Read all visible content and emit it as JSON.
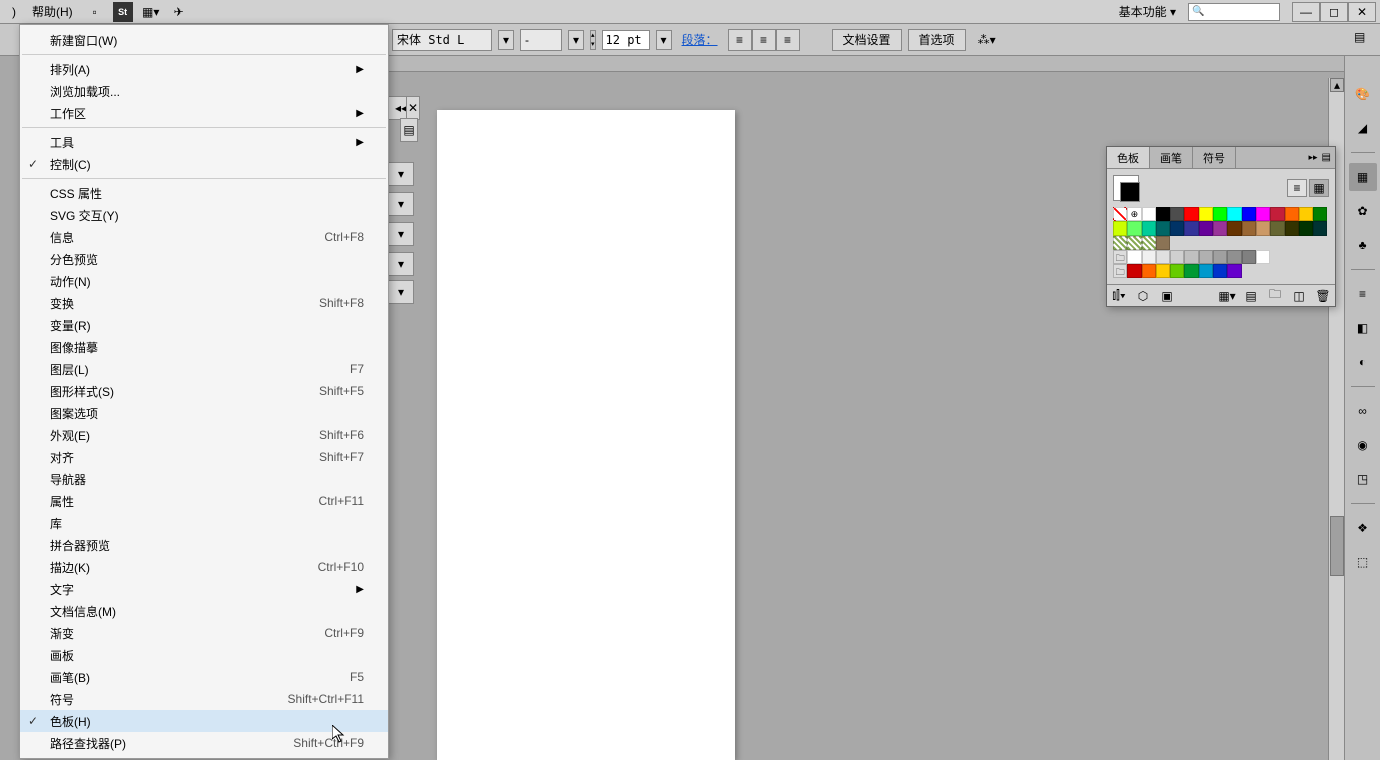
{
  "menubar": {
    "left_truncated": ")",
    "help": "帮助(H)",
    "workspace_switcher": "基本功能",
    "search_placeholder": ""
  },
  "controlbar": {
    "font_name": "宋体 Std L",
    "font_style": "-",
    "font_size": "12 pt",
    "paragraph_link": "段落：",
    "doc_setup": "文档设置",
    "preferences": "首选项"
  },
  "dropdown": {
    "items": [
      {
        "label": "新建窗口(W)"
      },
      {
        "sep": true
      },
      {
        "label": "排列(A)",
        "submenu": true
      },
      {
        "label": "浏览加载项..."
      },
      {
        "label": "工作区",
        "submenu": true
      },
      {
        "sep": true
      },
      {
        "label": "工具",
        "submenu": true
      },
      {
        "label": "控制(C)",
        "checked": true
      },
      {
        "sep": true
      },
      {
        "label": "CSS 属性"
      },
      {
        "label": "SVG 交互(Y)"
      },
      {
        "label": "信息",
        "shortcut": "Ctrl+F8"
      },
      {
        "label": "分色预览"
      },
      {
        "label": "动作(N)"
      },
      {
        "label": "变换",
        "shortcut": "Shift+F8"
      },
      {
        "label": "变量(R)"
      },
      {
        "label": "图像描摹"
      },
      {
        "label": "图层(L)",
        "shortcut": "F7"
      },
      {
        "label": "图形样式(S)",
        "shortcut": "Shift+F5"
      },
      {
        "label": "图案选项"
      },
      {
        "label": "外观(E)",
        "shortcut": "Shift+F6"
      },
      {
        "label": "对齐",
        "shortcut": "Shift+F7"
      },
      {
        "label": "导航器"
      },
      {
        "label": "属性",
        "shortcut": "Ctrl+F11"
      },
      {
        "label": "库"
      },
      {
        "label": "拼合器预览"
      },
      {
        "label": "描边(K)",
        "shortcut": "Ctrl+F10"
      },
      {
        "label": "文字",
        "submenu": true
      },
      {
        "label": "文档信息(M)"
      },
      {
        "label": "渐变",
        "shortcut": "Ctrl+F9"
      },
      {
        "label": "画板"
      },
      {
        "label": "画笔(B)",
        "shortcut": "F5"
      },
      {
        "label": "符号",
        "shortcut": "Shift+Ctrl+F11"
      },
      {
        "label": "色板(H)",
        "checked": true,
        "highlighted": true
      },
      {
        "label": "路径查找器(P)",
        "shortcut": "Shift+Ctrl+F9"
      }
    ]
  },
  "swatch_panel": {
    "tabs": [
      "色板",
      "画笔",
      "符号"
    ],
    "active_tab": 0,
    "colors_row1": [
      "none",
      "registration",
      "#ffffff",
      "#000000",
      "#4d4d4d",
      "#ff0000",
      "#ffff00",
      "#00ff00",
      "#00ffff",
      "#0000ff",
      "#ff00ff",
      "#c41e3a",
      "#ff6600",
      "#ffcc00",
      "#008000"
    ],
    "colors_row2": [
      "#ccff00",
      "#66ff66",
      "#00cc99",
      "#006666",
      "#003366",
      "#333399",
      "#660099",
      "#993399",
      "#663300",
      "#996633",
      "#cc9966",
      "#666633",
      "#333300",
      "#003300",
      "#003333"
    ],
    "colors_row3": [
      "pattern1",
      "pattern2",
      "pattern3",
      "#8b7355"
    ],
    "grays": [
      "#ffffff",
      "#f0f0f0",
      "#e0e0e0",
      "#d0d0d0",
      "#c0c0c0",
      "#b0b0b0",
      "#a0a0a0",
      "#909090",
      "#808080",
      "#ffffff"
    ],
    "folder_colors": [
      "#cc0000",
      "#ff6600",
      "#ffcc00",
      "#66cc00",
      "#009933",
      "#0099cc",
      "#0033cc",
      "#6600cc"
    ]
  }
}
